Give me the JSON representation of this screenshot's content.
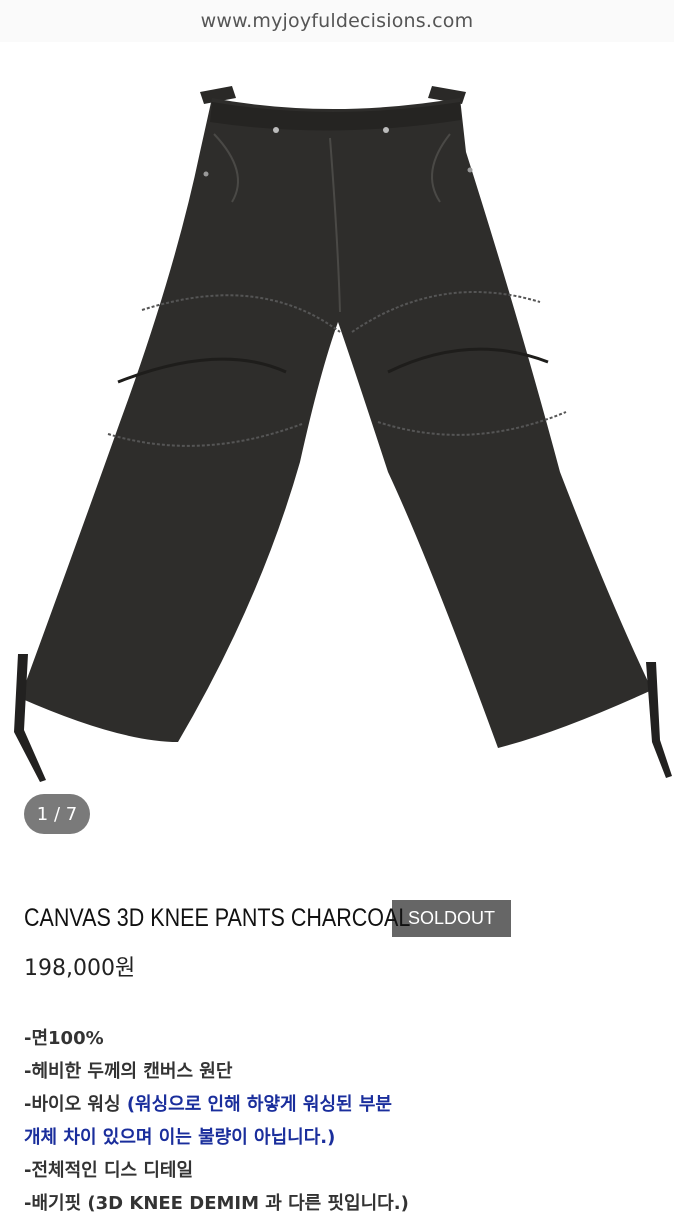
{
  "browser": {
    "url": "www.myjoyfuldecisions.com"
  },
  "gallery": {
    "image_name": "pants-photo",
    "counter": "1 / 7"
  },
  "product": {
    "title": "CANVAS 3D KNEE PANTS CHARCOAL",
    "badge": "SOLDOUT",
    "price": "198,000원"
  },
  "description": {
    "line1": "-면100%",
    "line2": "-헤비한 두께의 캔버스 원단",
    "line3_prefix": "-바이오 워싱 ",
    "line3_blue": "(워싱으로 인해 하얗게 워싱된 부분",
    "line4_blue": "개체 차이 있으며 이는 불량이 아닙니다.)",
    "line5": "-전체적인 디스 디테일",
    "line6": "-배기핏 (3D KNEE DEMIM 과 다른 핏입니다.)"
  },
  "colors": {
    "link_blue": "#1a2e9c",
    "badge_bg": "#666666",
    "pants": "#2e2d2b"
  }
}
